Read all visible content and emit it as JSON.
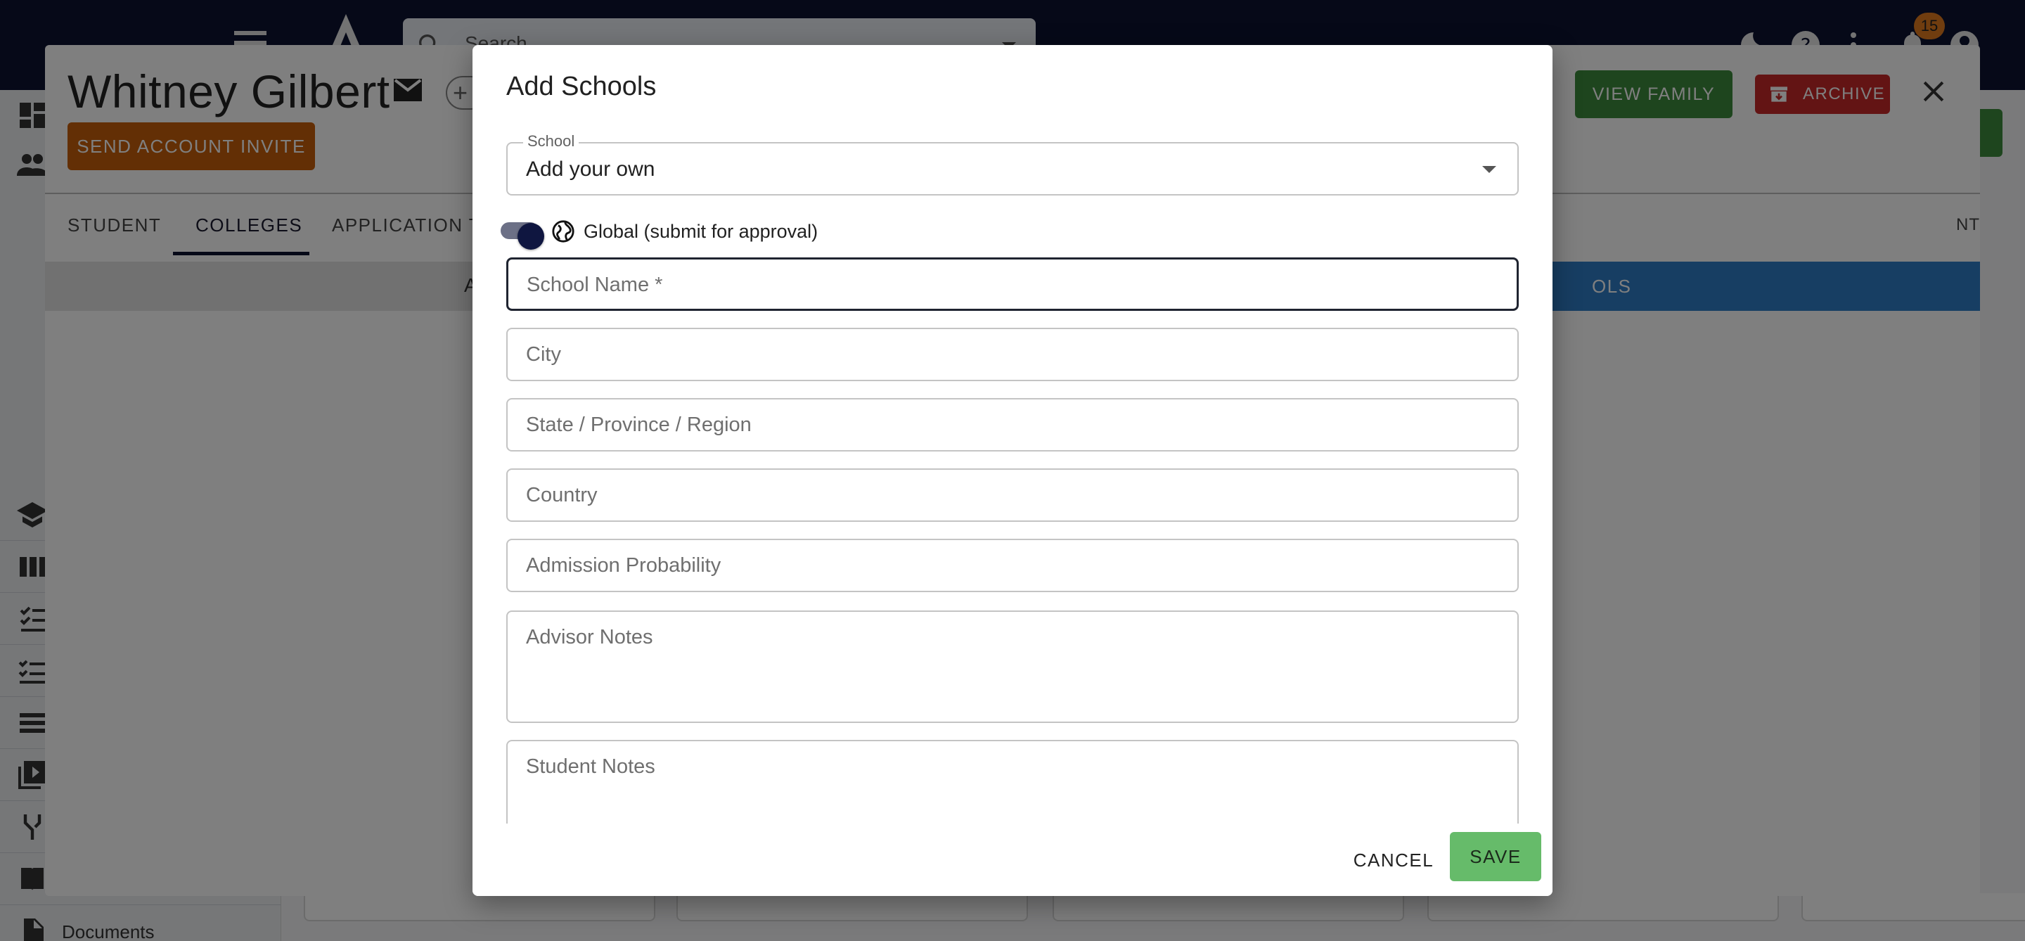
{
  "app": {
    "search_placeholder": "Search",
    "notification_count": "15"
  },
  "nav": {
    "documents_label": "Documents"
  },
  "student": {
    "name": "Whitney Gilbert",
    "send_invite_label": "SEND ACCOUNT INVITE",
    "view_family_label": "VIEW FAMILY",
    "archive_label": "ARCHIVE",
    "tabs": [
      {
        "label": "STUDENT"
      },
      {
        "label": "COLLEGES"
      },
      {
        "label": "APPLICATION TR"
      }
    ],
    "tab_right_label": "NT",
    "subbar_left_label": "A",
    "subbar_right_label": "OLS"
  },
  "modal": {
    "title": "Add Schools",
    "school_select": {
      "label": "School",
      "value": "Add your own"
    },
    "global_toggle": {
      "label": "Global (submit for approval)",
      "checked": true
    },
    "fields": {
      "school_name": "School Name *",
      "city": "City",
      "state": "State / Province / Region",
      "country": "Country",
      "admission_probability": "Admission Probability",
      "advisor_notes": "Advisor Notes",
      "student_notes": "Student Notes"
    },
    "cancel_label": "CANCEL",
    "save_label": "SAVE"
  },
  "colors": {
    "topbar": "#0c1330",
    "invite_button": "#c75f0a",
    "family_button": "#3d8b3d",
    "archive_button": "#c62828",
    "save_button": "#66bb6a",
    "tab_bar_blue": "#2f7cc7"
  }
}
